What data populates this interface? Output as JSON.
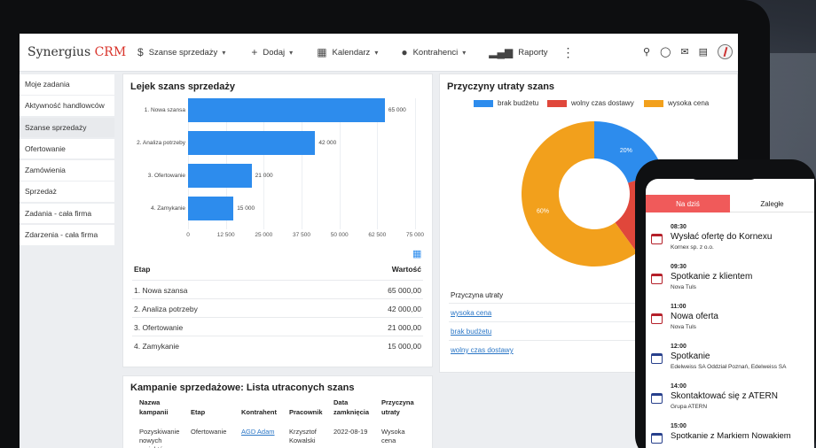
{
  "brand": {
    "name": "Synergius",
    "suffix": "CRM",
    "accent": "#d9342b"
  },
  "nav": [
    {
      "label": "Szanse sprzedaży",
      "icon": "dollar-icon",
      "dropdown": true
    },
    {
      "label": "Dodaj",
      "icon": "plus-icon",
      "dropdown": true
    },
    {
      "label": "Kalendarz",
      "icon": "calendar-icon",
      "dropdown": true
    },
    {
      "label": "Kontrahenci",
      "icon": "user-icon",
      "dropdown": true
    },
    {
      "label": "Raporty",
      "icon": "signal-icon",
      "dropdown": false
    }
  ],
  "sidebar": {
    "items": [
      {
        "label": "Moje zadania"
      },
      {
        "label": "Aktywność handlowców"
      },
      {
        "label": "Szanse sprzedaży",
        "active": true
      },
      {
        "label": "Ofertowanie"
      },
      {
        "label": "Zamówienia"
      },
      {
        "label": "Sprzedaż"
      },
      {
        "label": "Zadania - cała firma"
      },
      {
        "label": "Zdarzenia - cała firma"
      }
    ]
  },
  "funnel": {
    "title": "Lejek szans sprzedaży",
    "chart_data": {
      "type": "bar",
      "orientation": "horizontal",
      "categories": [
        "1. Nowa szansa",
        "2. Analiza potrzeby",
        "3. Ofertowanie",
        "4. Zamykanie"
      ],
      "values": [
        65000,
        42000,
        21000,
        15000
      ],
      "value_labels": [
        "65 000",
        "42 000",
        "21 000",
        "15 000"
      ],
      "xlim": [
        0,
        75000
      ],
      "xticks": [
        "0",
        "12 500",
        "25 000",
        "37 500",
        "50 000",
        "62 500",
        "75 000"
      ],
      "color": "#2d8ced"
    },
    "table": {
      "headers": [
        "Etap",
        "Wartość"
      ],
      "rows": [
        [
          "1. Nowa szansa",
          "65 000,00"
        ],
        [
          "2. Analiza potrzeby",
          "42 000,00"
        ],
        [
          "3. Ofertowanie",
          "21 000,00"
        ],
        [
          "4. Zamykanie",
          "15 000,00"
        ]
      ]
    }
  },
  "loss": {
    "title": "Przyczyny utraty szans",
    "chart_data": {
      "type": "pie",
      "donut": true,
      "labels": [
        "brak budżetu",
        "wolny czas dostawy",
        "wysoka cena"
      ],
      "values": [
        20,
        20,
        60
      ],
      "slice_labels": [
        "20%",
        "",
        "60%"
      ],
      "colors": [
        "#2d8ced",
        "#e0473b",
        "#f2a01c"
      ]
    },
    "table_header": "Przyczyna utraty",
    "reasons": [
      "wysoka cena",
      "brak budżetu",
      "wolny czas dostawy"
    ]
  },
  "campaigns": {
    "title": "Kampanie sprzedażowe: Lista utraconych szans",
    "headers": [
      "Nazwa kampanii",
      "Etap",
      "Kontrahent",
      "Pracownik",
      "Data zamknięcia",
      "Przyczyna utraty"
    ],
    "row": [
      "Pozyskiwanie nowych projektów",
      "Ofertowanie",
      "AGD Adam",
      "Krzysztof Kowalski",
      "2022-08-19",
      "Wysoka cena"
    ]
  },
  "phone": {
    "tabs": [
      "Na dziś",
      "Zaległe"
    ],
    "events": [
      {
        "time": "08:30",
        "title": "Wysłać ofertę do Kornexu",
        "sub": "Kornex sp. z o.o.",
        "color": "red"
      },
      {
        "time": "09:30",
        "title": "Spotkanie z klientem",
        "sub": "Nova Tuls",
        "color": "red"
      },
      {
        "time": "11:00",
        "title": "Nowa oferta",
        "sub": "Nova Tuls",
        "color": "red"
      },
      {
        "time": "12:00",
        "title": "Spotkanie",
        "sub": "Edelweiss SA Oddział Poznań, Edelweiss SA",
        "color": "blue"
      },
      {
        "time": "14:00",
        "title": "Skontaktować się z ATERN",
        "sub": "Grupa ATERN",
        "color": "blue"
      },
      {
        "time": "15:00",
        "title": "Spotkanie z Markiem Nowakiem",
        "sub": "",
        "color": "blue"
      }
    ]
  }
}
